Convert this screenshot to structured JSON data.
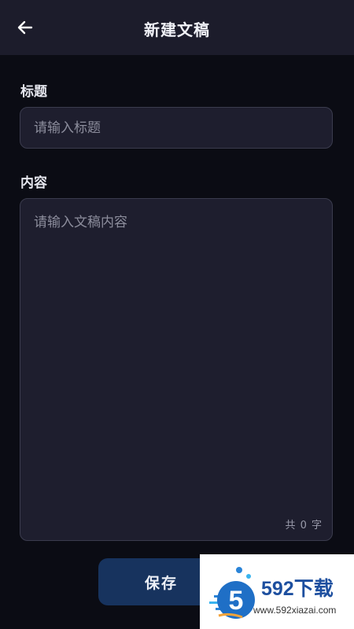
{
  "header": {
    "title": "新建文稿",
    "back_icon": "arrow-left-icon"
  },
  "form": {
    "title_label": "标题",
    "title_value": "",
    "title_placeholder": "请输入标题",
    "content_label": "内容",
    "content_value": "",
    "content_placeholder": "请输入文稿内容",
    "char_count": "共 0 字"
  },
  "actions": {
    "save_label": "保存"
  },
  "watermark": {
    "brand_text": "592下载",
    "url": "www.592xiazai.com"
  },
  "colors": {
    "background": "#0b0c14",
    "header": "#1c1c2b",
    "field": "#1e1e2e",
    "button": "#17335e"
  }
}
